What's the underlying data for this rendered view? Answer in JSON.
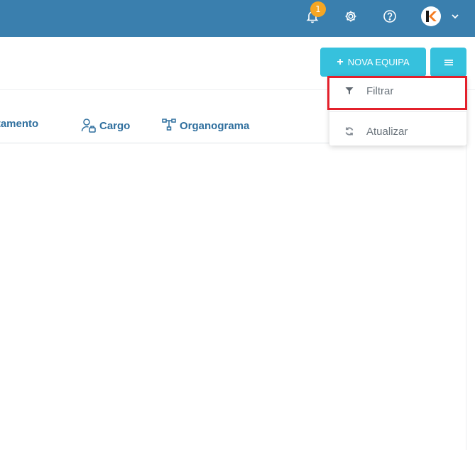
{
  "topbar": {
    "notification_count": "1",
    "icons": [
      "bell-icon",
      "gear-icon",
      "help-icon",
      "avatar",
      "chevron-down-icon"
    ],
    "color": "#3a7fae"
  },
  "actions": {
    "new_team_label": "NOVA EQUIPA",
    "accent": "#36c1dd"
  },
  "tabs": [
    {
      "label": "rtamento"
    },
    {
      "label": "Cargo"
    },
    {
      "label": "Organograma"
    }
  ],
  "menu": {
    "items": [
      {
        "label": "Filtrar",
        "icon": "filter-icon"
      },
      {
        "label": "Atualizar",
        "icon": "refresh-icon"
      }
    ]
  },
  "highlight_color": "#e3202b"
}
